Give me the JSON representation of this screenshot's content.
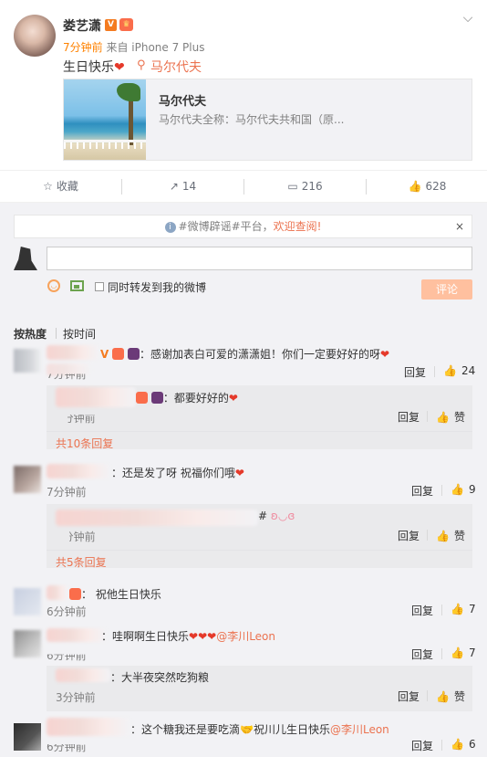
{
  "post": {
    "username": "娄艺潇",
    "vbadge": "V",
    "meta_time": "7分钟前",
    "meta_source": "来自 iPhone 7 Plus",
    "text": "生日快乐",
    "heart": "❤",
    "location": "马尔代夫",
    "card_title": "马尔代夫",
    "card_desc": "马尔代夫全称：马尔代夫共和国（原..."
  },
  "actions": {
    "favorite": "收藏",
    "repost": "14",
    "comment": "216",
    "like": "628"
  },
  "comment_box": {
    "notice_prefix": "#微博辟谣#平台，",
    "notice_link": "欢迎查阅!",
    "notice_close": "×",
    "repost_label": "同时转发到我的微博",
    "submit": "评论"
  },
  "sort": {
    "hot": "按热度",
    "time": "按时间"
  },
  "comments": [
    {
      "text": "：感谢加表白可爱的潇潇姐！你们一定要好好的呀",
      "time": "7分钟前",
      "reply": "回复",
      "likes": "24",
      "sub": [
        {
          "text": "：都要好好的",
          "time": "6分钟前",
          "reply": "回复",
          "likes": "赞"
        }
      ],
      "more": "共10条回复"
    },
    {
      "text": "：还是发了呀 祝福你们哦",
      "time": "7分钟前",
      "reply": "回复",
      "likes": "9",
      "sub": [
        {
          "text": "#",
          "time": "6分钟前",
          "reply": "回复",
          "likes": "赞"
        }
      ],
      "more": "共5条回复"
    },
    {
      "text": "祝他生日快乐",
      "time": "6分钟前",
      "reply": "回复",
      "likes": "7"
    },
    {
      "text": "：哇啊啊生日快乐",
      "mention": "@李川Leon",
      "time": "6分钟前",
      "reply": "回复",
      "likes": "7",
      "sub": [
        {
          "text": "：大半夜突然吃狗粮",
          "time": "3分钟前",
          "reply": "回复",
          "likes": "赞"
        }
      ]
    },
    {
      "text": "：这个糖我还是要吃滴",
      "text2": "祝川儿生日快乐",
      "mention": "@李川Leon",
      "time": "6分钟前",
      "reply": "回复",
      "likes": "6"
    }
  ]
}
